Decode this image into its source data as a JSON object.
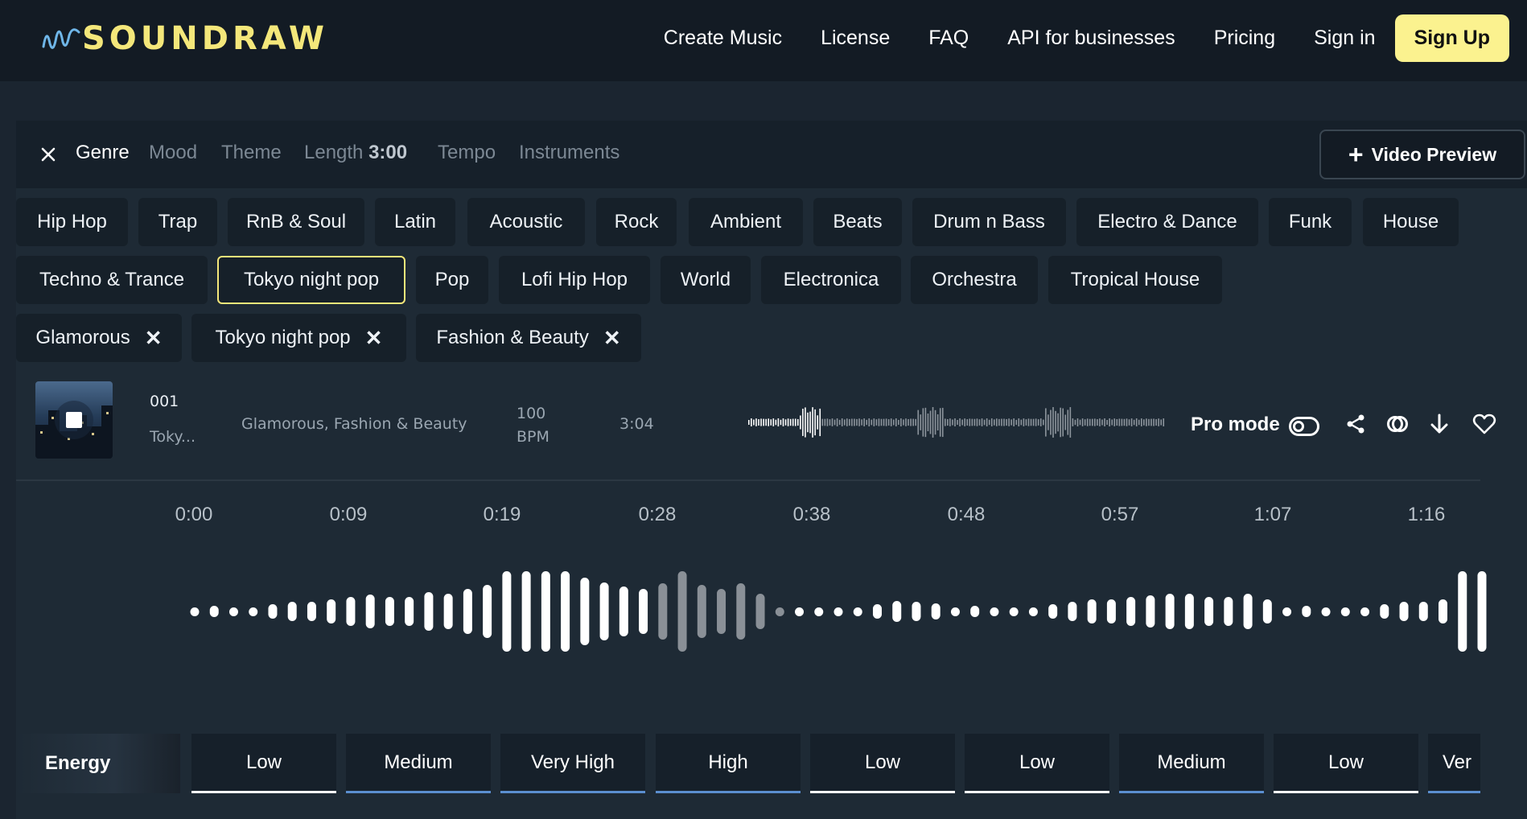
{
  "brand": {
    "name": "SOUNDRAW",
    "color": "#f4e77a"
  },
  "nav": {
    "links": [
      "Create Music",
      "License",
      "FAQ",
      "API for businesses",
      "Pricing",
      "Sign in"
    ],
    "signup": "Sign Up"
  },
  "filter_tabs": {
    "genre": "Genre",
    "mood": "Mood",
    "theme": "Theme",
    "length_label": "Length",
    "length_value": "3:00",
    "tempo": "Tempo",
    "instruments": "Instruments"
  },
  "video_preview": "Video Preview",
  "genres_row1": [
    "Hip Hop",
    "Trap",
    "RnB & Soul",
    "Latin",
    "Acoustic",
    "Rock",
    "Ambient",
    "Beats",
    "Drum n Bass",
    "Electro & Dance",
    "Funk",
    "House"
  ],
  "genres_row2": [
    "Techno & Trance",
    "Tokyo night pop",
    "Pop",
    "Lofi Hip Hop",
    "World",
    "Electronica",
    "Orchestra",
    "Tropical House"
  ],
  "selected_genre": "Tokyo night pop",
  "active_filters": [
    "Glamorous",
    "Tokyo night pop",
    "Fashion & Beauty"
  ],
  "track": {
    "number": "001",
    "name": "Toky...",
    "tags": "Glamorous, Fashion & Beauty",
    "bpm_value": "100",
    "bpm_unit": "BPM",
    "length": "3:04",
    "pro_mode": "Pro mode",
    "pro_mode_on": false
  },
  "timeline": [
    "0:00",
    "0:09",
    "0:19",
    "0:28",
    "0:38",
    "0:48",
    "0:57",
    "1:07",
    "1:16"
  ],
  "energy": {
    "label": "Energy",
    "levels": [
      "Low",
      "Medium",
      "Very High",
      "High",
      "Low",
      "Low",
      "Medium",
      "Low",
      "Ver"
    ],
    "blue_underline": [
      false,
      true,
      true,
      true,
      false,
      false,
      true,
      false,
      true
    ]
  }
}
